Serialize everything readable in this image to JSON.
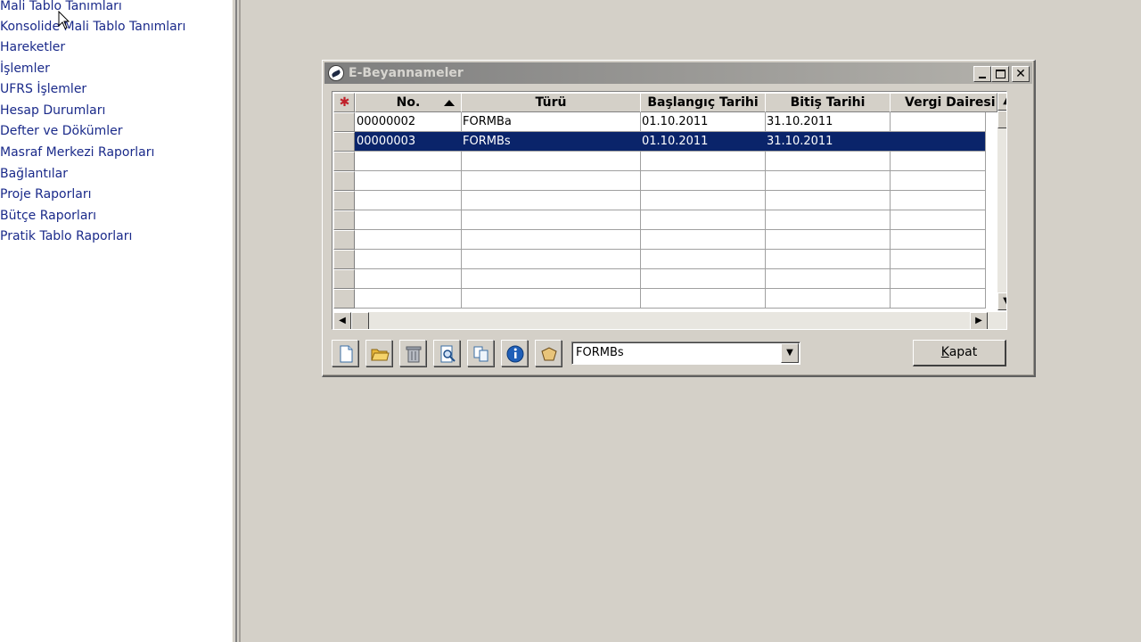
{
  "nav": {
    "items": [
      "Mali Tablo Tanımları",
      "Konsolide Mali Tablo Tanımları",
      "Hareketler",
      "İşlemler",
      "UFRS İşlemler",
      "Hesap Durumları",
      "Defter ve Dökümler",
      "Masraf Merkezi Raporları",
      "Bağlantılar",
      "Proje Raporları",
      "Bütçe Raporları",
      "Pratik Tablo Raporları"
    ]
  },
  "dialog": {
    "title": "E-Beyannameler",
    "columns": [
      "No.",
      "Türü",
      "Başlangıç Tarihi",
      "Bitiş Tarihi",
      "Vergi Dairesi"
    ],
    "rows": [
      [
        "00000002",
        "FORMBa",
        "01.10.2011",
        "31.10.2011",
        ""
      ],
      [
        "00000003",
        "FORMBs",
        "01.10.2011",
        "31.10.2011",
        ""
      ]
    ],
    "selected_row": 1,
    "empty_rows": 8,
    "combo_value": "FORMBs",
    "close_button": {
      "prefix": "",
      "accel": "K",
      "rest": "apat"
    },
    "toolbar_icons": [
      "new-document-icon",
      "open-folder-icon",
      "delete-trash-icon",
      "preview-icon",
      "copy-icon",
      "info-icon",
      "shape-icon"
    ]
  },
  "colors": {
    "nav_text": "#1a2a8a",
    "selection": "#0a246a",
    "window_face": "#d4d0c8"
  }
}
